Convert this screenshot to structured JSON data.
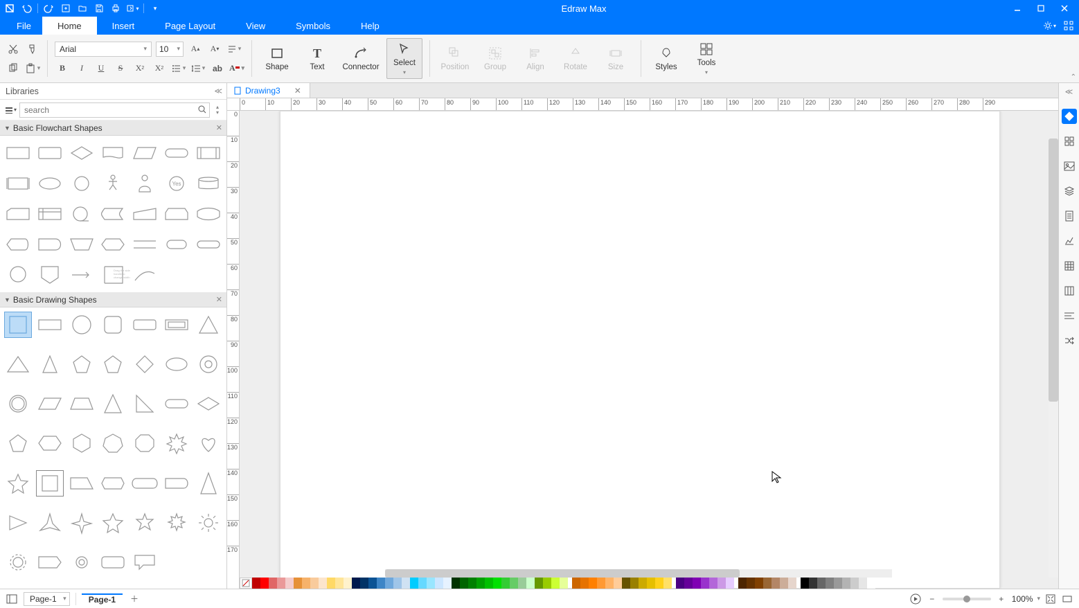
{
  "app": {
    "title": "Edraw Max"
  },
  "menu": {
    "tabs": [
      "File",
      "Home",
      "Insert",
      "Page Layout",
      "View",
      "Symbols",
      "Help"
    ],
    "active": "Home"
  },
  "ribbon": {
    "font_name": "Arial",
    "font_size": "10",
    "tools": {
      "shape": "Shape",
      "text": "Text",
      "connector": "Connector",
      "select": "Select",
      "position": "Position",
      "group": "Group",
      "align": "Align",
      "rotate": "Rotate",
      "size": "Size",
      "styles": "Styles",
      "tools_label": "Tools"
    }
  },
  "libraries": {
    "title": "Libraries",
    "search_placeholder": "search",
    "cat1": "Basic Flowchart Shapes",
    "cat2": "Basic Drawing Shapes"
  },
  "document": {
    "tab_name": "Drawing3"
  },
  "ruler_h": [
    0,
    10,
    20,
    30,
    40,
    50,
    60,
    70,
    80,
    90,
    100,
    110,
    120,
    130,
    140,
    150,
    160,
    170,
    180,
    190,
    200,
    210,
    220,
    230,
    240,
    250,
    260,
    270,
    280,
    290
  ],
  "ruler_v": [
    0,
    10,
    20,
    30,
    40,
    50,
    60,
    70,
    80,
    90,
    100,
    110,
    120,
    130,
    140,
    150,
    160,
    170
  ],
  "colors": [
    "#c00000",
    "#ff0000",
    "#e06666",
    "#ea9999",
    "#f4cccc",
    "#e69138",
    "#f6b26b",
    "#f9cb9c",
    "#fce5cd",
    "#ffd966",
    "#ffe599",
    "#fff2cc",
    "#001a4d",
    "#003366",
    "#0b5394",
    "#3d85c6",
    "#6fa8dc",
    "#9fc5e8",
    "#cfe2f3",
    "#00ccff",
    "#66d9ff",
    "#99e6ff",
    "#cce6ff",
    "#e6f2ff",
    "#003300",
    "#006400",
    "#008000",
    "#00a000",
    "#00c000",
    "#00e000",
    "#33cc33",
    "#66cc66",
    "#99cc99",
    "#ccffcc",
    "#669900",
    "#99cc00",
    "#ccff33",
    "#e6ff99",
    "#sep",
    "#cc6600",
    "#e67300",
    "#ff8000",
    "#ff9933",
    "#ffb366",
    "#ffcc99",
    "#665200",
    "#998000",
    "#ccaa00",
    "#e6bf00",
    "#ffd11a",
    "#ffe066",
    "#sep",
    "#4b0082",
    "#660099",
    "#8000b3",
    "#9933cc",
    "#b366d9",
    "#cc99e6",
    "#e6ccff",
    "#sep",
    "#4d2600",
    "#663300",
    "#804000",
    "#996633",
    "#b38666",
    "#ccad99",
    "#e6d5cc",
    "#sep",
    "#000000",
    "#333333",
    "#666666",
    "#808080",
    "#999999",
    "#b3b3b3",
    "#cccccc",
    "#e6e6e6",
    "#ffffff"
  ],
  "status": {
    "page_selector": "Page-1",
    "page_tab": "Page-1",
    "zoom": "100%"
  }
}
